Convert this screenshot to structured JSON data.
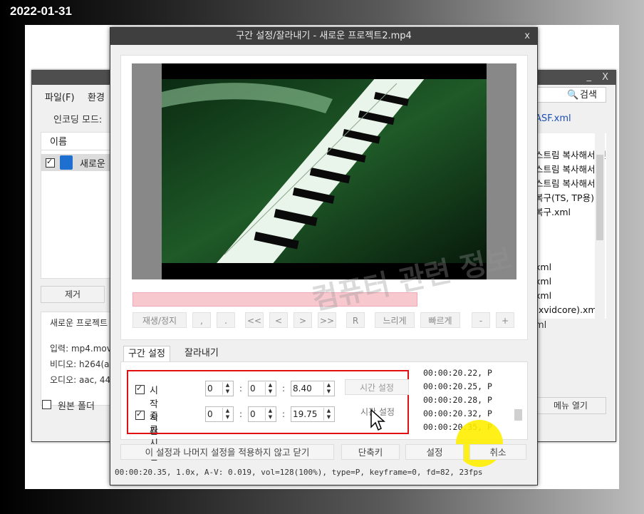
{
  "date_overlay": "2022-01-31",
  "main_window": {
    "min_glyph": "_",
    "close_glyph": "X",
    "menu": [
      "파일(F)",
      "환경"
    ],
    "encoding_mode_label": "인코딩 모드:",
    "list_header": "이름",
    "list_item": "새로운",
    "remove_button": "제거",
    "info_title": "새로운 프로젝트",
    "info_lines": [
      "입력: mp4.mov",
      "비디오: h264(a",
      "오디오: aac, 44"
    ],
    "source_folder_label": "원본 폴더",
    "search_label": "검색",
    "right_top_item": "ASF.xml",
    "right_items": [
      "스트림 복사해서 인",
      "스트림 복사해서",
      "스트림 복사해서",
      "복구(TS, TP용)",
      "복구.xml",
      "",
      "",
      "xml",
      "xml",
      "xml",
      "(xvidcore).xml",
      "ml"
    ],
    "open_menu_button": "메뉴 열기"
  },
  "dialog": {
    "title": "구간 설정/잘라내기 - 새로운 프로젝트2.mp4",
    "close_glyph": "x",
    "controls": [
      "재생/정지",
      ",",
      ".",
      "<<",
      "<",
      ">",
      ">>",
      "R",
      "느리게",
      "빠르게",
      "-",
      "+"
    ],
    "progress_pct": 0,
    "tabs": [
      "구간 설정",
      "잘라내기"
    ],
    "start_label": "시작시간",
    "end_label": "종료시간",
    "start": {
      "h": "0",
      "m": "0",
      "s": "8.40"
    },
    "end": {
      "h": "0",
      "m": "0",
      "s": "19.75"
    },
    "colon": ":",
    "set_time_button": "시간 설정",
    "log": [
      "00:00:20.22, P",
      "00:00:20.25, P",
      "00:00:20.28, P",
      "00:00:20.32, P",
      "00:00:20.35, P"
    ],
    "close_without_apply": "이 설정과 나머지 설정을 적용하지 않고 닫기",
    "hotkey_button": "단축키",
    "settings_button": "설정",
    "cancel_button": "취소",
    "status": "00:00:20.35, 1.0x, A-V:  0.019, vol=128(100%), type=P, keyframe=0, fd=82, 23fps",
    "watermark": "컴퓨터 관련 정보"
  },
  "colors": {
    "highlight": "#ffee00",
    "red_box": "#e01010",
    "progress": "#f8c8cf"
  }
}
